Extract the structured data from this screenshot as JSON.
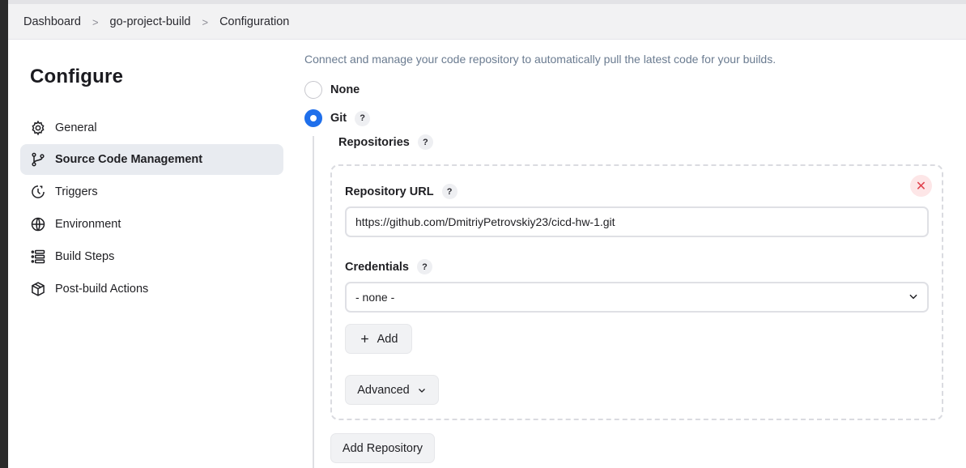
{
  "breadcrumb": {
    "items": [
      "Dashboard",
      "go-project-build",
      "Configuration"
    ],
    "separator": ">"
  },
  "sidebar": {
    "title": "Configure",
    "items": [
      {
        "label": "General",
        "icon": "gear-icon"
      },
      {
        "label": "Source Code Management",
        "icon": "branch-icon",
        "active": true
      },
      {
        "label": "Triggers",
        "icon": "clock-icon"
      },
      {
        "label": "Environment",
        "icon": "globe-icon"
      },
      {
        "label": "Build Steps",
        "icon": "list-icon"
      },
      {
        "label": "Post-build Actions",
        "icon": "package-icon"
      }
    ]
  },
  "scm": {
    "description": "Connect and manage your code repository to automatically pull the latest code for your builds.",
    "options": [
      {
        "label": "None",
        "selected": false
      },
      {
        "label": "Git",
        "selected": true
      }
    ],
    "repositories_label": "Repositories",
    "help": "?",
    "repository": {
      "url_label": "Repository URL",
      "url_value": "https://github.com/DmitriyPetrovskiy23/cicd-hw-1.git",
      "credentials_label": "Credentials",
      "credentials_value": "- none -",
      "add_label": "Add",
      "advanced_label": "Advanced",
      "remove_symbol": "✕"
    },
    "add_repository_label": "Add Repository"
  },
  "colors": {
    "accent": "#1f6feb",
    "active_nav_bg": "#e8ebf0",
    "remove_bg": "#fde6e7",
    "remove_fg": "#e0424d",
    "description": "#6a7b90"
  }
}
